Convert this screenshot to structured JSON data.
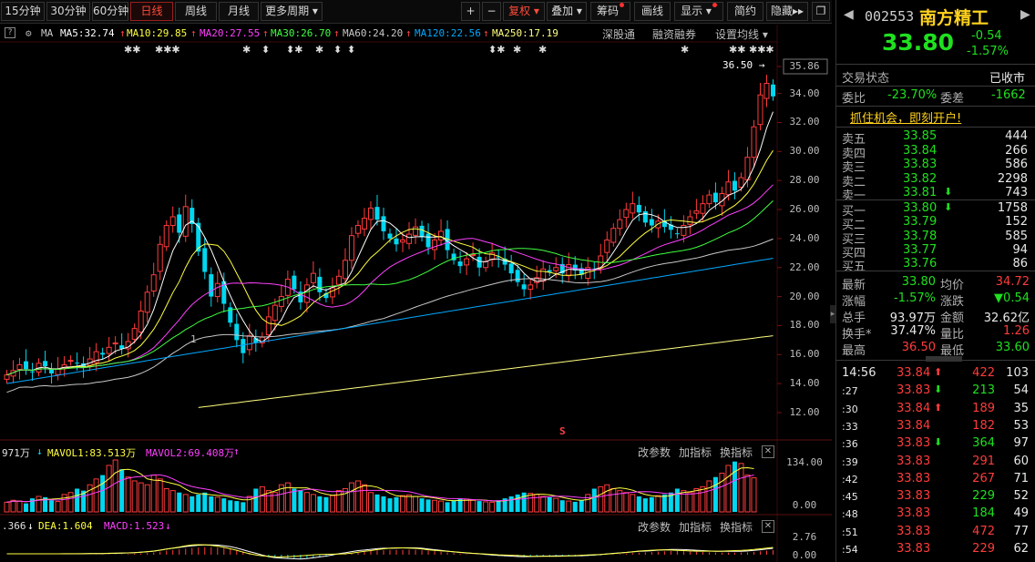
{
  "toolbar": {
    "periods": [
      "15分钟",
      "30分钟",
      "60分钟",
      "日线",
      "周线",
      "月线",
      "更多周期"
    ],
    "active_period": "日线",
    "plus": "+",
    "minus": "−",
    "fuquan": "复权",
    "overlay": "叠加",
    "chips": "筹码",
    "draw": "画线",
    "display": "显示",
    "simple": "简约",
    "hide": "隐藏"
  },
  "ma_row": {
    "help": "?",
    "ma_label": "MA",
    "ma5": "MA5:32.74",
    "ma10": "MA10:29.85",
    "ma20": "MA20:27.55",
    "ma30": "MA30:26.70",
    "ma60": "MA60:24.20",
    "ma120": "MA120:22.56",
    "ma250": "MA250:17.19",
    "shengutong": "深股通",
    "rongzi": "融资融券",
    "settings": "设置均线"
  },
  "markers": [
    "✱✱",
    "✱✱✱",
    "✱",
    "⬍",
    "⬍✱",
    "✱",
    "⬍",
    "⬍",
    "⬍✱",
    "✱",
    "✱",
    "✱",
    "✱✱",
    "✱✱✱"
  ],
  "price_chart": {
    "high_label": "36.50",
    "y_ticks": [
      "35.86",
      "34.00",
      "32.00",
      "30.00",
      "28.00",
      "26.00",
      "24.00",
      "22.00",
      "20.00",
      "18.00",
      "16.00",
      "14.00",
      "12.00"
    ],
    "s_marker": "S",
    "tick_low": "1"
  },
  "volume": {
    "value": "971万",
    "mavol1": "MAVOL1:83.513万",
    "mavol2": "MAVOL2:69.408万",
    "change_param": "改参数",
    "add_indicator": "加指标",
    "switch_indicator": "换指标",
    "close": "✕",
    "y_ticks": [
      "134.00",
      "0.00"
    ]
  },
  "macd": {
    "dif": ".366",
    "dea": "DEA:1.604",
    "macd": "MACD:1.523",
    "change_param": "改参数",
    "add_indicator": "加指标",
    "switch_indicator": "换指标",
    "close": "✕",
    "y_ticks": [
      "2.76",
      "0.00"
    ]
  },
  "quote": {
    "code": "002553",
    "name": "南方精工",
    "price": "33.80",
    "change": "-0.54",
    "change_pct": "-1.57%",
    "status_label": "交易状态",
    "status_value": "已收市",
    "weibi_label": "委比",
    "weibi_value": "-23.70%",
    "weicha_label": "委差",
    "weicha_value": "-1662",
    "promo": "抓住机会，即刻开户!",
    "sell": [
      {
        "label": "卖五",
        "price": "33.85",
        "vol": "444"
      },
      {
        "label": "卖四",
        "price": "33.84",
        "vol": "266"
      },
      {
        "label": "卖三",
        "price": "33.83",
        "vol": "586"
      },
      {
        "label": "卖二",
        "price": "33.82",
        "vol": "2298"
      },
      {
        "label": "卖一",
        "price": "33.81",
        "vol": "743"
      }
    ],
    "buy": [
      {
        "label": "买一",
        "price": "33.80",
        "vol": "1758"
      },
      {
        "label": "买二",
        "price": "33.79",
        "vol": "152"
      },
      {
        "label": "买三",
        "price": "33.78",
        "vol": "585"
      },
      {
        "label": "买四",
        "price": "33.77",
        "vol": "94"
      },
      {
        "label": "买五",
        "price": "33.76",
        "vol": "86"
      }
    ],
    "stats": [
      {
        "l1": "最新",
        "v1": "33.80",
        "l2": "均价",
        "v2": "34.72"
      },
      {
        "l1": "涨幅",
        "v1": "-1.57%",
        "l2": "涨跌",
        "v2": "▼0.54"
      },
      {
        "l1": "总手",
        "v1": "93.97万",
        "l2": "金额",
        "v2": "32.62亿"
      },
      {
        "l1": "换手*",
        "v1": "37.47%",
        "l2": "量比",
        "v2": "1.26"
      },
      {
        "l1": "最高",
        "v1": "36.50",
        "l2": "最低",
        "v2": "33.60"
      }
    ],
    "ticks": [
      {
        "time": "14:56",
        "price": "33.84",
        "dir": "up",
        "vol": "422",
        "num": "103"
      },
      {
        "time": ":27",
        "price": "33.83",
        "dir": "down",
        "vol": "213",
        "num": "54"
      },
      {
        "time": ":30",
        "price": "33.84",
        "dir": "up",
        "vol": "189",
        "num": "35"
      },
      {
        "time": ":33",
        "price": "33.84",
        "dir": "",
        "vol": "182",
        "num": "53"
      },
      {
        "time": ":36",
        "price": "33.83",
        "dir": "down",
        "vol": "364",
        "num": "97"
      },
      {
        "time": ":39",
        "price": "33.83",
        "dir": "",
        "vol": "291",
        "num": "60"
      },
      {
        "time": ":42",
        "price": "33.83",
        "dir": "",
        "vol": "267",
        "num": "71"
      },
      {
        "time": ":45",
        "price": "33.83",
        "dir": "",
        "vol": "229",
        "num": "52"
      },
      {
        "time": ":48",
        "price": "33.83",
        "dir": "",
        "vol": "184",
        "num": "49"
      },
      {
        "time": ":51",
        "price": "33.83",
        "dir": "",
        "vol": "472",
        "num": "77"
      },
      {
        "time": ":54",
        "price": "33.83",
        "dir": "",
        "vol": "229",
        "num": "62"
      }
    ]
  },
  "colors": {
    "up": "#ff3b3b",
    "down": "#00d7f0",
    "ma5": "#ffffff",
    "ma10": "#ffff40",
    "ma20": "#ff40ff",
    "ma30": "#40ff40",
    "ma60": "#c8c8c8",
    "ma120": "#00a8ff",
    "ma250": "#ffff80"
  },
  "chart_data": {
    "type": "candlestick",
    "ylim": [
      11.0,
      36.5
    ],
    "closes": [
      14.6,
      14.9,
      15.3,
      15.0,
      14.8,
      15.4,
      15.2,
      14.7,
      15.0,
      15.3,
      15.6,
      15.4,
      15.1,
      15.7,
      16.2,
      16.0,
      16.5,
      16.8,
      16.4,
      16.9,
      17.8,
      19.0,
      20.3,
      21.5,
      23.6,
      24.9,
      25.5,
      24.4,
      26.2,
      25.0,
      23.1,
      21.7,
      20.0,
      20.9,
      19.5,
      18.2,
      17.0,
      16.1,
      17.3,
      16.8,
      17.2,
      18.6,
      19.4,
      20.0,
      21.2,
      20.5,
      19.6,
      20.8,
      21.6,
      20.3,
      19.9,
      20.6,
      21.4,
      22.5,
      24.2,
      24.9,
      25.4,
      26.1,
      25.3,
      24.5,
      24.0,
      23.6,
      23.9,
      24.3,
      24.8,
      24.1,
      23.4,
      23.9,
      24.5,
      23.2,
      22.5,
      22.1,
      22.6,
      22.9,
      22.0,
      22.4,
      23.0,
      22.7,
      22.2,
      21.6,
      21.0,
      20.5,
      20.8,
      21.3,
      21.9,
      21.7,
      22.0,
      21.6,
      22.2,
      21.8,
      21.5,
      22.0,
      21.9,
      22.8,
      23.9,
      24.7,
      25.3,
      26.0,
      26.4,
      25.8,
      25.1,
      24.9,
      25.2,
      24.8,
      24.6,
      24.3,
      24.9,
      25.5,
      25.9,
      26.4,
      27.0,
      26.5,
      27.1,
      27.9,
      27.3,
      28.2,
      29.6,
      31.7,
      33.9,
      34.7,
      33.8
    ],
    "volumes": [
      25,
      30,
      28,
      22,
      35,
      40,
      38,
      30,
      27,
      45,
      50,
      60,
      55,
      70,
      85,
      95,
      120,
      134,
      110,
      90,
      80,
      75,
      70,
      95,
      85,
      60,
      55,
      50,
      45,
      40,
      45,
      50,
      40,
      38,
      35,
      30,
      28,
      25,
      40,
      60,
      65,
      55,
      50,
      70,
      75,
      60,
      55,
      50,
      45,
      40,
      38,
      42,
      55,
      60,
      75,
      80,
      70,
      50,
      45,
      40,
      35,
      38,
      42,
      44,
      40,
      35,
      32,
      30,
      28,
      25,
      30,
      35,
      33,
      30,
      28,
      26,
      25,
      30,
      35,
      40,
      45,
      50,
      48,
      45,
      40,
      38,
      35,
      30,
      28,
      26,
      30,
      45,
      60,
      65,
      70,
      60,
      55,
      50,
      45,
      40,
      35,
      38,
      42,
      45,
      50,
      60,
      55,
      50,
      60,
      65,
      80,
      90,
      100,
      120,
      130,
      125,
      95,
      88
    ],
    "series_names": [
      "MA5",
      "MA10",
      "MA20",
      "MA30",
      "MA60",
      "MA120",
      "MA250"
    ]
  }
}
